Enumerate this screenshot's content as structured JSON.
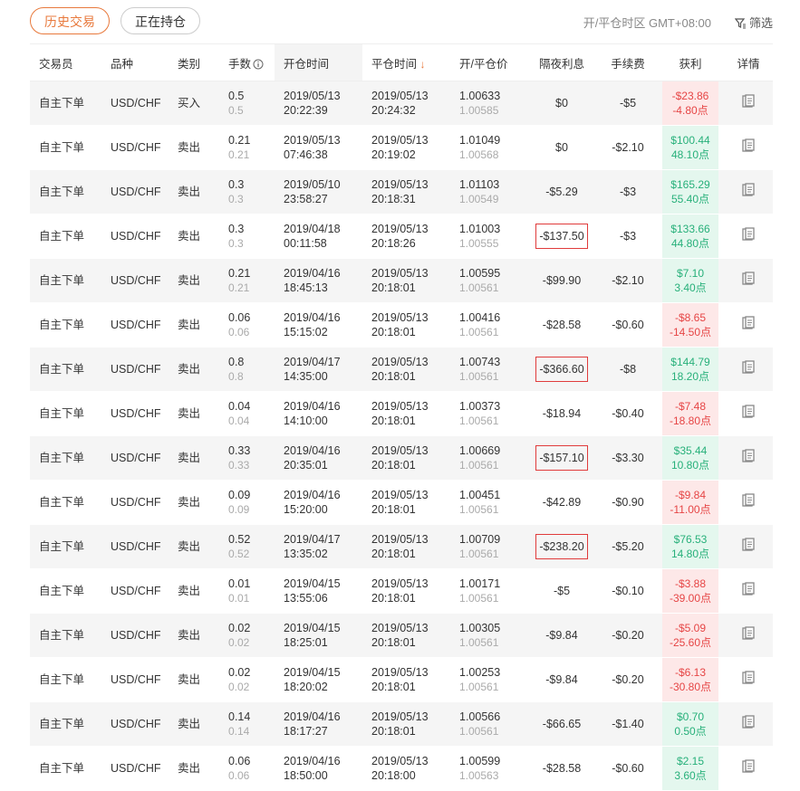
{
  "tabs": {
    "history": "历史交易",
    "open": "正在持仓"
  },
  "timezone": "开/平仓时区 GMT+08:00",
  "filter_label": "筛选",
  "columns": {
    "trader": "交易员",
    "symbol": "品种",
    "side": "类别",
    "lots": "手数",
    "open_time": "开仓时间",
    "close_time": "平仓时间",
    "price": "开/平仓价",
    "swap": "隔夜利息",
    "fee": "手续费",
    "pnl": "获利",
    "detail": "详情"
  },
  "sort_arrow": "↓",
  "rows": [
    {
      "trader": "自主下单",
      "symbol": "USD/CHF",
      "side": "买入",
      "lots": "0.5",
      "lots_sub": "0.5",
      "open_date": "2019/05/13",
      "open_time": "20:22:39",
      "close_date": "2019/05/13",
      "close_time": "20:24:32",
      "open_price": "1.00633",
      "close_price": "1.00585",
      "swap": "$0",
      "fee": "-$5",
      "pnl": "-$23.86",
      "pnl_pts": "-4.80点",
      "pnl_type": "neg",
      "swap_boxed": false
    },
    {
      "trader": "自主下单",
      "symbol": "USD/CHF",
      "side": "卖出",
      "lots": "0.21",
      "lots_sub": "0.21",
      "open_date": "2019/05/13",
      "open_time": "07:46:38",
      "close_date": "2019/05/13",
      "close_time": "20:19:02",
      "open_price": "1.01049",
      "close_price": "1.00568",
      "swap": "$0",
      "fee": "-$2.10",
      "pnl": "$100.44",
      "pnl_pts": "48.10点",
      "pnl_type": "pos",
      "swap_boxed": false
    },
    {
      "trader": "自主下单",
      "symbol": "USD/CHF",
      "side": "卖出",
      "lots": "0.3",
      "lots_sub": "0.3",
      "open_date": "2019/05/10",
      "open_time": "23:58:27",
      "close_date": "2019/05/13",
      "close_time": "20:18:31",
      "open_price": "1.01103",
      "close_price": "1.00549",
      "swap": "-$5.29",
      "fee": "-$3",
      "pnl": "$165.29",
      "pnl_pts": "55.40点",
      "pnl_type": "pos",
      "swap_boxed": false
    },
    {
      "trader": "自主下单",
      "symbol": "USD/CHF",
      "side": "卖出",
      "lots": "0.3",
      "lots_sub": "0.3",
      "open_date": "2019/04/18",
      "open_time": "00:11:58",
      "close_date": "2019/05/13",
      "close_time": "20:18:26",
      "open_price": "1.01003",
      "close_price": "1.00555",
      "swap": "-$137.50",
      "fee": "-$3",
      "pnl": "$133.66",
      "pnl_pts": "44.80点",
      "pnl_type": "pos",
      "swap_boxed": true
    },
    {
      "trader": "自主下单",
      "symbol": "USD/CHF",
      "side": "卖出",
      "lots": "0.21",
      "lots_sub": "0.21",
      "open_date": "2019/04/16",
      "open_time": "18:45:13",
      "close_date": "2019/05/13",
      "close_time": "20:18:01",
      "open_price": "1.00595",
      "close_price": "1.00561",
      "swap": "-$99.90",
      "fee": "-$2.10",
      "pnl": "$7.10",
      "pnl_pts": "3.40点",
      "pnl_type": "pos",
      "swap_boxed": false
    },
    {
      "trader": "自主下单",
      "symbol": "USD/CHF",
      "side": "卖出",
      "lots": "0.06",
      "lots_sub": "0.06",
      "open_date": "2019/04/16",
      "open_time": "15:15:02",
      "close_date": "2019/05/13",
      "close_time": "20:18:01",
      "open_price": "1.00416",
      "close_price": "1.00561",
      "swap": "-$28.58",
      "fee": "-$0.60",
      "pnl": "-$8.65",
      "pnl_pts": "-14.50点",
      "pnl_type": "neg",
      "swap_boxed": false
    },
    {
      "trader": "自主下单",
      "symbol": "USD/CHF",
      "side": "卖出",
      "lots": "0.8",
      "lots_sub": "0.8",
      "open_date": "2019/04/17",
      "open_time": "14:35:00",
      "close_date": "2019/05/13",
      "close_time": "20:18:01",
      "open_price": "1.00743",
      "close_price": "1.00561",
      "swap": "-$366.60",
      "fee": "-$8",
      "pnl": "$144.79",
      "pnl_pts": "18.20点",
      "pnl_type": "pos",
      "swap_boxed": true
    },
    {
      "trader": "自主下单",
      "symbol": "USD/CHF",
      "side": "卖出",
      "lots": "0.04",
      "lots_sub": "0.04",
      "open_date": "2019/04/16",
      "open_time": "14:10:00",
      "close_date": "2019/05/13",
      "close_time": "20:18:01",
      "open_price": "1.00373",
      "close_price": "1.00561",
      "swap": "-$18.94",
      "fee": "-$0.40",
      "pnl": "-$7.48",
      "pnl_pts": "-18.80点",
      "pnl_type": "neg",
      "swap_boxed": false
    },
    {
      "trader": "自主下单",
      "symbol": "USD/CHF",
      "side": "卖出",
      "lots": "0.33",
      "lots_sub": "0.33",
      "open_date": "2019/04/16",
      "open_time": "20:35:01",
      "close_date": "2019/05/13",
      "close_time": "20:18:01",
      "open_price": "1.00669",
      "close_price": "1.00561",
      "swap": "-$157.10",
      "fee": "-$3.30",
      "pnl": "$35.44",
      "pnl_pts": "10.80点",
      "pnl_type": "pos",
      "swap_boxed": true
    },
    {
      "trader": "自主下单",
      "symbol": "USD/CHF",
      "side": "卖出",
      "lots": "0.09",
      "lots_sub": "0.09",
      "open_date": "2019/04/16",
      "open_time": "15:20:00",
      "close_date": "2019/05/13",
      "close_time": "20:18:01",
      "open_price": "1.00451",
      "close_price": "1.00561",
      "swap": "-$42.89",
      "fee": "-$0.90",
      "pnl": "-$9.84",
      "pnl_pts": "-11.00点",
      "pnl_type": "neg",
      "swap_boxed": false
    },
    {
      "trader": "自主下单",
      "symbol": "USD/CHF",
      "side": "卖出",
      "lots": "0.52",
      "lots_sub": "0.52",
      "open_date": "2019/04/17",
      "open_time": "13:35:02",
      "close_date": "2019/05/13",
      "close_time": "20:18:01",
      "open_price": "1.00709",
      "close_price": "1.00561",
      "swap": "-$238.20",
      "fee": "-$5.20",
      "pnl": "$76.53",
      "pnl_pts": "14.80点",
      "pnl_type": "pos",
      "swap_boxed": true
    },
    {
      "trader": "自主下单",
      "symbol": "USD/CHF",
      "side": "卖出",
      "lots": "0.01",
      "lots_sub": "0.01",
      "open_date": "2019/04/15",
      "open_time": "13:55:06",
      "close_date": "2019/05/13",
      "close_time": "20:18:01",
      "open_price": "1.00171",
      "close_price": "1.00561",
      "swap": "-$5",
      "fee": "-$0.10",
      "pnl": "-$3.88",
      "pnl_pts": "-39.00点",
      "pnl_type": "neg",
      "swap_boxed": false
    },
    {
      "trader": "自主下单",
      "symbol": "USD/CHF",
      "side": "卖出",
      "lots": "0.02",
      "lots_sub": "0.02",
      "open_date": "2019/04/15",
      "open_time": "18:25:01",
      "close_date": "2019/05/13",
      "close_time": "20:18:01",
      "open_price": "1.00305",
      "close_price": "1.00561",
      "swap": "-$9.84",
      "fee": "-$0.20",
      "pnl": "-$5.09",
      "pnl_pts": "-25.60点",
      "pnl_type": "neg",
      "swap_boxed": false
    },
    {
      "trader": "自主下单",
      "symbol": "USD/CHF",
      "side": "卖出",
      "lots": "0.02",
      "lots_sub": "0.02",
      "open_date": "2019/04/15",
      "open_time": "18:20:02",
      "close_date": "2019/05/13",
      "close_time": "20:18:01",
      "open_price": "1.00253",
      "close_price": "1.00561",
      "swap": "-$9.84",
      "fee": "-$0.20",
      "pnl": "-$6.13",
      "pnl_pts": "-30.80点",
      "pnl_type": "neg",
      "swap_boxed": false
    },
    {
      "trader": "自主下单",
      "symbol": "USD/CHF",
      "side": "卖出",
      "lots": "0.14",
      "lots_sub": "0.14",
      "open_date": "2019/04/16",
      "open_time": "18:17:27",
      "close_date": "2019/05/13",
      "close_time": "20:18:01",
      "open_price": "1.00566",
      "close_price": "1.00561",
      "swap": "-$66.65",
      "fee": "-$1.40",
      "pnl": "$0.70",
      "pnl_pts": "0.50点",
      "pnl_type": "pos",
      "swap_boxed": false
    },
    {
      "trader": "自主下单",
      "symbol": "USD/CHF",
      "side": "卖出",
      "lots": "0.06",
      "lots_sub": "0.06",
      "open_date": "2019/04/16",
      "open_time": "18:50:00",
      "close_date": "2019/05/13",
      "close_time": "20:18:00",
      "open_price": "1.00599",
      "close_price": "1.00563",
      "swap": "-$28.58",
      "fee": "-$0.60",
      "pnl": "$2.15",
      "pnl_pts": "3.60点",
      "pnl_type": "pos",
      "swap_boxed": false
    }
  ],
  "colors": {
    "accent": "#e8793c",
    "loss": "#e64545",
    "loss_bg": "#fde8e8",
    "profit": "#27b07a",
    "profit_bg": "#e4f7ee",
    "highlight_box": "#e03b3b"
  }
}
